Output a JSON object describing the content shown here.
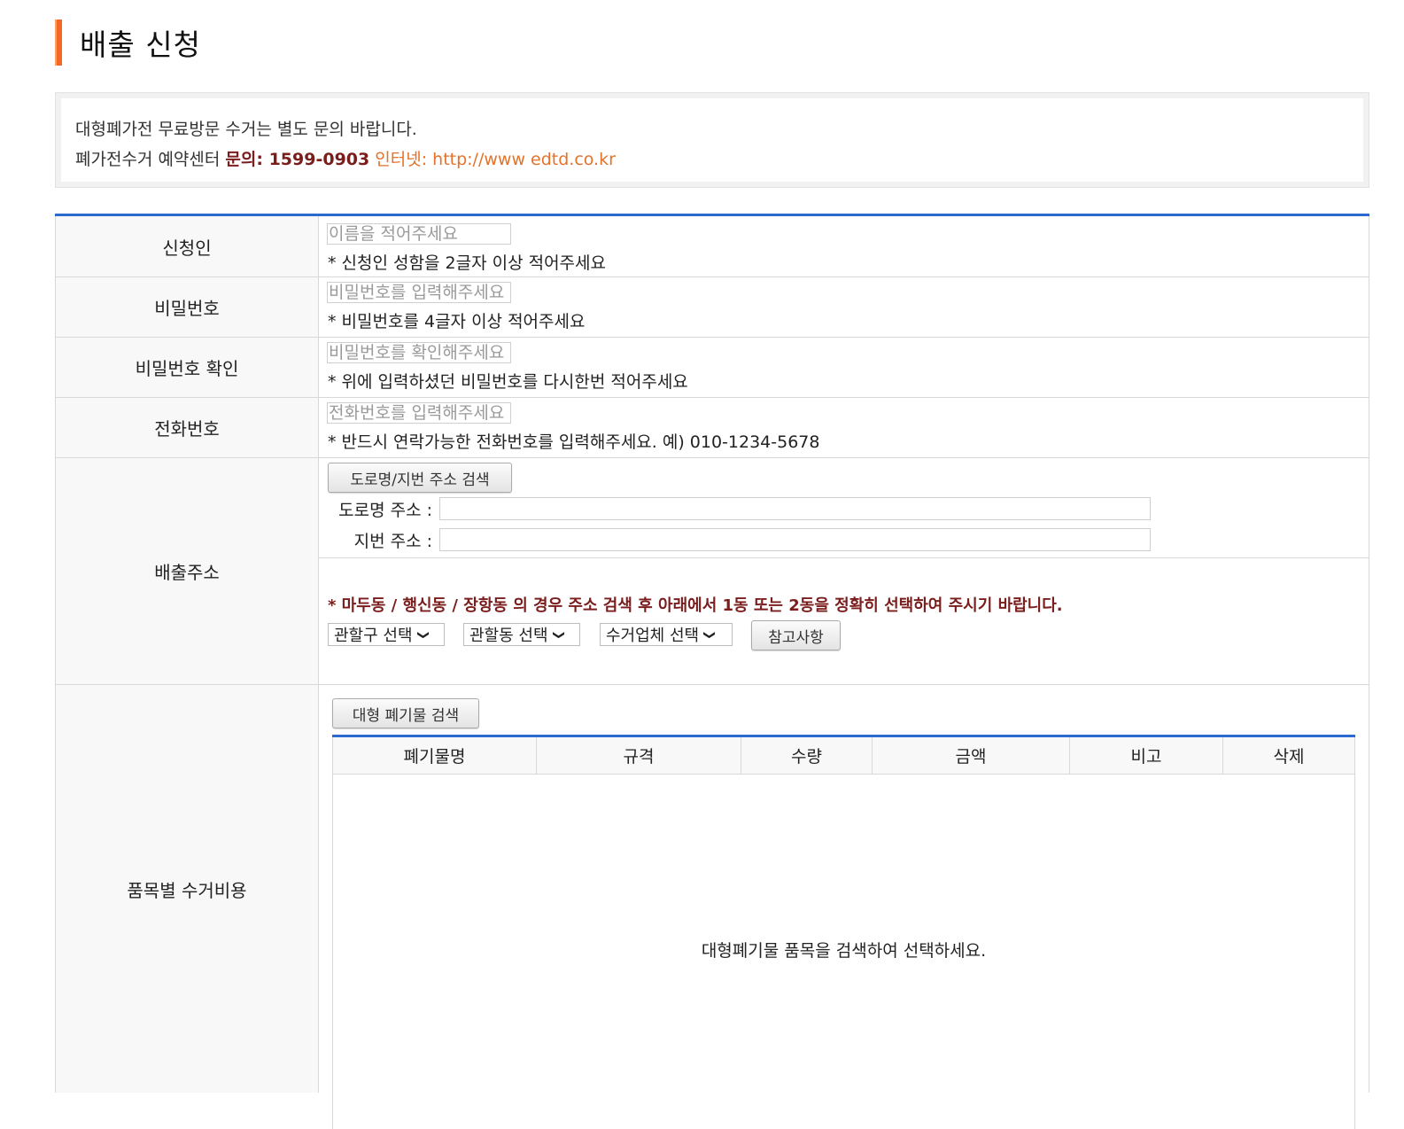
{
  "page": {
    "title": "배출 신청"
  },
  "notice": {
    "line1": "대형폐가전 무료방문 수거는 별도 문의 바랍니다.",
    "line2_prefix": "폐가전수거 예약센터 ",
    "line2_phone": "문의: 1599-0903",
    "line2_internet": " 인터넷: http://www edtd.co.kr"
  },
  "form": {
    "applicant": {
      "label": "신청인",
      "placeholder": "이름을 적어주세요",
      "hint": "* 신청인 성함을 2글자 이상 적어주세요"
    },
    "password": {
      "label": "비밀번호",
      "placeholder": "비밀번호를 입력해주세요",
      "hint": "* 비밀번호를 4글자 이상 적어주세요"
    },
    "password_confirm": {
      "label": "비밀번호 확인",
      "placeholder": "비밀번호를 확인해주세요",
      "hint": "* 위에 입력하셨던 비밀번호를 다시한번 적어주세요"
    },
    "phone": {
      "label": "전화번호",
      "placeholder": "전화번호를 입력해주세요",
      "hint": "* 반드시 연락가능한 전화번호를 입력해주세요. 예) 010-1234-5678"
    },
    "address": {
      "label": "배출주소",
      "search_button": "도로명/지번 주소 검색",
      "road_label": "도로명 주소 :",
      "road_value": "",
      "jibun_label": "지번 주소 :",
      "jibun_value": "",
      "warning": "* 마두동 / 행신동 / 장항동 의 경우 주소 검색 후 아래에서 1동 또는 2동을 정확히 선택하여 주시기 바랍니다.",
      "district_select": "관할구 선택",
      "dong_select": "관할동 선택",
      "company_select": "수거업체 선택",
      "reference_button": "참고사항"
    },
    "items": {
      "label": "품목별 수거비용",
      "search_button": "대형 폐기물 검색",
      "columns": [
        "폐기물명",
        "규격",
        "수량",
        "금액",
        "비고",
        "삭제"
      ],
      "empty_message": "대형폐기물 품목을 검색하여 선택하세요."
    }
  }
}
